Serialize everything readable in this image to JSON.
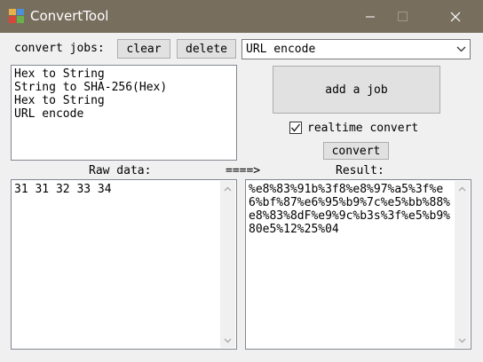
{
  "window": {
    "title": "ConvertTool"
  },
  "jobs": {
    "label": "convert jobs:",
    "clear_label": "clear",
    "delete_label": "delete",
    "selected_type": "URL encode",
    "list": [
      "Hex to String",
      "String to SHA-256(Hex)",
      "Hex to String",
      "URL encode"
    ],
    "add_label": "add a job",
    "realtime_label": "realtime convert",
    "realtime_checked": true,
    "convert_label": "convert"
  },
  "io": {
    "raw_label": "Raw data:",
    "arrow_label": "====>",
    "result_label": "Result:",
    "raw_value": "31 31 32 33 34",
    "result_value": "%e8%83%91b%3f8%e8%97%a5%3f%e6%bf%87%e6%95%b9%7c%e5%bb%88%e8%83%8dF%e9%9c%b3s%3f%e5%b9%80e5%12%25%04"
  },
  "icons": {
    "app": "app-icon",
    "minimize": "minimize-icon",
    "maximize": "maximize-icon",
    "close": "close-icon",
    "dropdown": "chevron-down-icon",
    "check": "checkmark-icon",
    "scroll_up": "scroll-up-arrow-icon",
    "scroll_down": "scroll-down-arrow-icon"
  },
  "colors": {
    "titlebar": "#786e5e",
    "window_bg": "#f0f0f0",
    "button_bg": "#e1e1e1"
  }
}
